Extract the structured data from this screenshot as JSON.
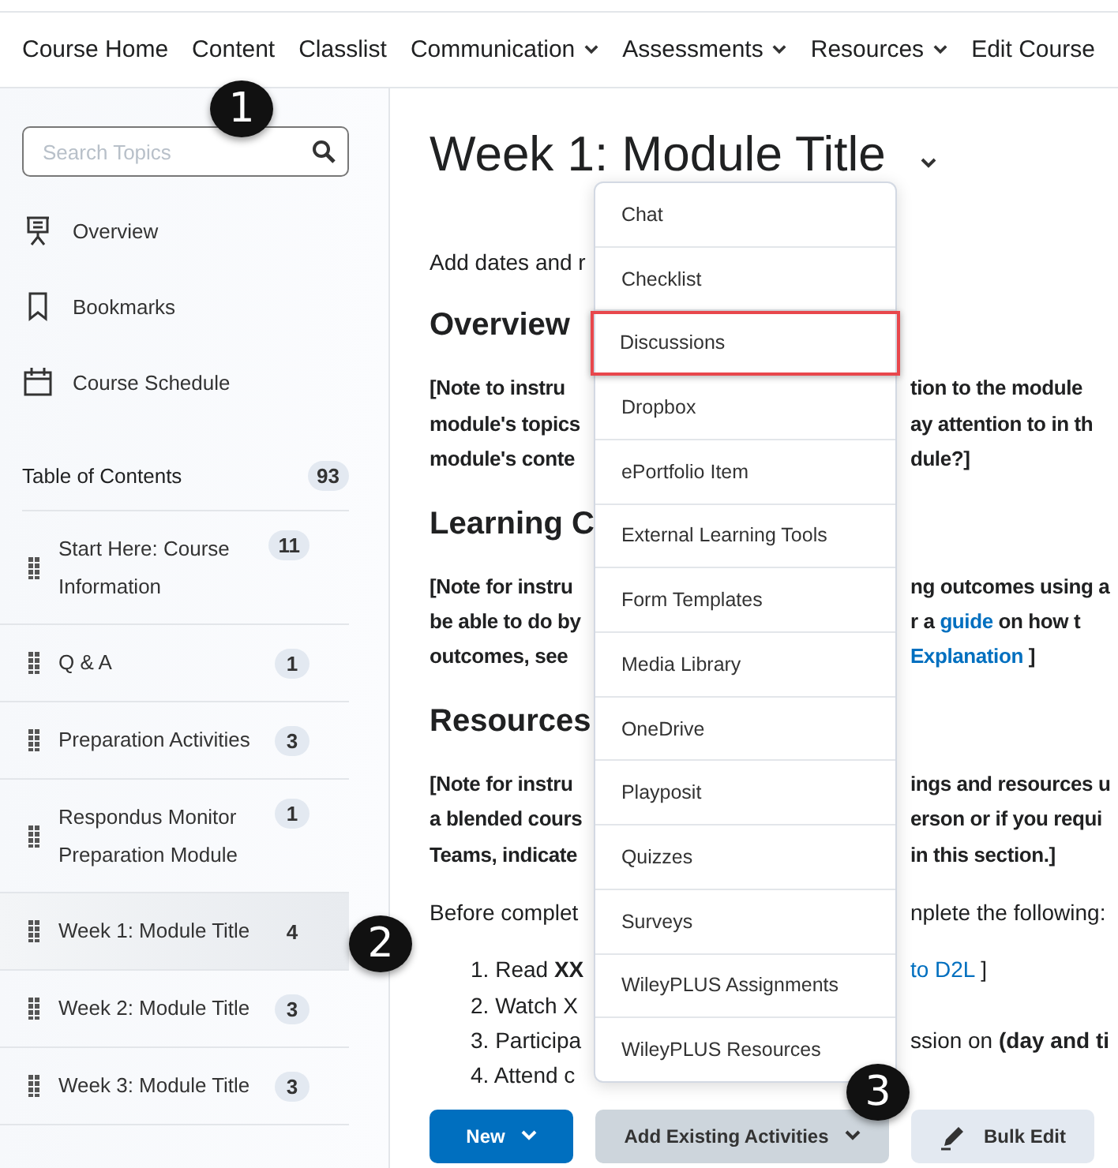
{
  "nav": [
    {
      "label": "Course Home",
      "dropdown": false
    },
    {
      "label": "Content",
      "dropdown": false
    },
    {
      "label": "Classlist",
      "dropdown": false
    },
    {
      "label": "Communication",
      "dropdown": true
    },
    {
      "label": "Assessments",
      "dropdown": true
    },
    {
      "label": "Resources",
      "dropdown": true
    },
    {
      "label": "Edit Course",
      "dropdown": false
    }
  ],
  "sidebar": {
    "search": {
      "placeholder": "Search Topics"
    },
    "links": [
      {
        "label": "Overview"
      },
      {
        "label": "Bookmarks"
      },
      {
        "label": "Course Schedule"
      }
    ],
    "toc": {
      "label": "Table of Contents",
      "count": "93"
    },
    "modules": [
      {
        "title": "Start Here: Course Information",
        "count": "11",
        "selected": false
      },
      {
        "title": "Q & A",
        "count": "1",
        "selected": false
      },
      {
        "title": "Preparation Activities",
        "count": "3",
        "selected": false
      },
      {
        "title": "Respondus Monitor Preparation Module",
        "count": "1",
        "selected": false
      },
      {
        "title": "Week 1: Module Title",
        "count": "4",
        "selected": true
      },
      {
        "title": "Week 2: Module Title",
        "count": "3",
        "selected": false
      },
      {
        "title": "Week 3: Module Title",
        "count": "3",
        "selected": false
      }
    ]
  },
  "main": {
    "title": "Week 1: Module Title",
    "blocks": [
      {
        "kind": "para",
        "lines": [
          {
            "left": [
              {
                "text": "Add dates and r",
                "link": false
              }
            ]
          }
        ]
      },
      {
        "kind": "heading",
        "lines": [
          {
            "left": [
              {
                "text": "Overview",
                "link": false
              }
            ]
          }
        ]
      },
      {
        "kind": "note",
        "lines": [
          {
            "left": [
              {
                "text": "[Note to instru",
                "link": false
              }
            ],
            "right": [
              {
                "text": "tion to the module",
                "link": false
              }
            ]
          },
          {
            "left": [
              {
                "text": "module's topics",
                "link": false
              }
            ],
            "right": [
              {
                "text": "ay attention to in th",
                "link": false
              }
            ]
          },
          {
            "left": [
              {
                "text": "module's conte",
                "link": false
              }
            ],
            "right": [
              {
                "text": "dule?]",
                "link": false
              }
            ]
          }
        ]
      },
      {
        "kind": "heading",
        "lines": [
          {
            "left": [
              {
                "text": "Learning C",
                "link": false
              }
            ]
          }
        ]
      },
      {
        "kind": "note",
        "lines": [
          {
            "left": [
              {
                "text": "[Note for instru",
                "link": false
              }
            ],
            "right": [
              {
                "text": "ng outcomes using a",
                "link": false
              }
            ]
          },
          {
            "left": [
              {
                "text": "be able to do by",
                "link": false
              }
            ],
            "right": [
              {
                "text": "r a",
                "link": false
              },
              {
                "text": "guide",
                "link": true
              },
              {
                "text": "on how t",
                "link": false
              }
            ]
          },
          {
            "left": [
              {
                "text": "outcomes, see",
                "link": false
              }
            ],
            "right": [
              {
                "text": "Explanation",
                "link": true
              },
              {
                "text": "]",
                "link": false
              }
            ]
          }
        ]
      },
      {
        "kind": "heading",
        "lines": [
          {
            "left": [
              {
                "text": "Resources",
                "link": false
              }
            ]
          }
        ]
      },
      {
        "kind": "note",
        "lines": [
          {
            "left": [
              {
                "text": "[Note for instru",
                "link": false
              }
            ],
            "right": [
              {
                "text": "ings and resources u",
                "link": false
              }
            ]
          },
          {
            "left": [
              {
                "text": "a blended cours",
                "link": false
              }
            ],
            "right": [
              {
                "text": "erson or if you requi",
                "link": false
              }
            ]
          },
          {
            "left": [
              {
                "text": "Teams, indicate",
                "link": false
              }
            ],
            "right": [
              {
                "text": "in this section.]",
                "link": false
              }
            ]
          }
        ]
      },
      {
        "kind": "para",
        "lines": [
          {
            "left": [
              {
                "text": "Before complet",
                "link": false
              }
            ],
            "right": [
              {
                "text": "nplete the following:",
                "link": false
              }
            ]
          }
        ]
      },
      {
        "kind": "list",
        "lines": [
          {
            "number": "1.",
            "left": [
              {
                "text": "Read **XX**",
                "link": false
              }
            ],
            "right": [
              {
                "text": "to D2L",
                "link": true
              },
              {
                "text": "]",
                "link": false
              }
            ]
          },
          {
            "number": "2.",
            "left": [
              {
                "text": "Watch X",
                "link": false
              }
            ]
          },
          {
            "number": "3.",
            "left": [
              {
                "text": "Participa",
                "link": false
              }
            ],
            "right": [
              {
                "text": "ssion on **(day and ti**",
                "link": false
              }
            ]
          },
          {
            "number": "4.",
            "left": [
              {
                "text": "Attend c",
                "link": false
              }
            ]
          }
        ]
      }
    ],
    "menu": {
      "items": [
        {
          "label": "Chat",
          "highlighted": false
        },
        {
          "label": "Checklist",
          "highlighted": false
        },
        {
          "label": "Discussions",
          "highlighted": true
        },
        {
          "label": "Dropbox",
          "highlighted": false
        },
        {
          "label": "ePortfolio Item",
          "highlighted": false
        },
        {
          "label": "External Learning Tools",
          "highlighted": false
        },
        {
          "label": "Form Templates",
          "highlighted": false
        },
        {
          "label": "Media Library",
          "highlighted": false
        },
        {
          "label": "OneDrive",
          "highlighted": false
        },
        {
          "label": "Playposit",
          "highlighted": false
        },
        {
          "label": "Quizzes",
          "highlighted": false
        },
        {
          "label": "Surveys",
          "highlighted": false
        },
        {
          "label": "WileyPLUS Assignments",
          "highlighted": false
        },
        {
          "label": "WileyPLUS Resources",
          "highlighted": false
        }
      ]
    },
    "buttons": [
      {
        "label": "New",
        "kind": "primary",
        "dropdown": true
      },
      {
        "label": "Add Existing Activities",
        "kind": "open",
        "dropdown": true
      },
      {
        "label": "Bulk Edit",
        "kind": "edit",
        "dropdown": false
      }
    ]
  },
  "callouts": [
    {
      "number": "1"
    },
    {
      "number": "2"
    },
    {
      "number": "3"
    }
  ]
}
